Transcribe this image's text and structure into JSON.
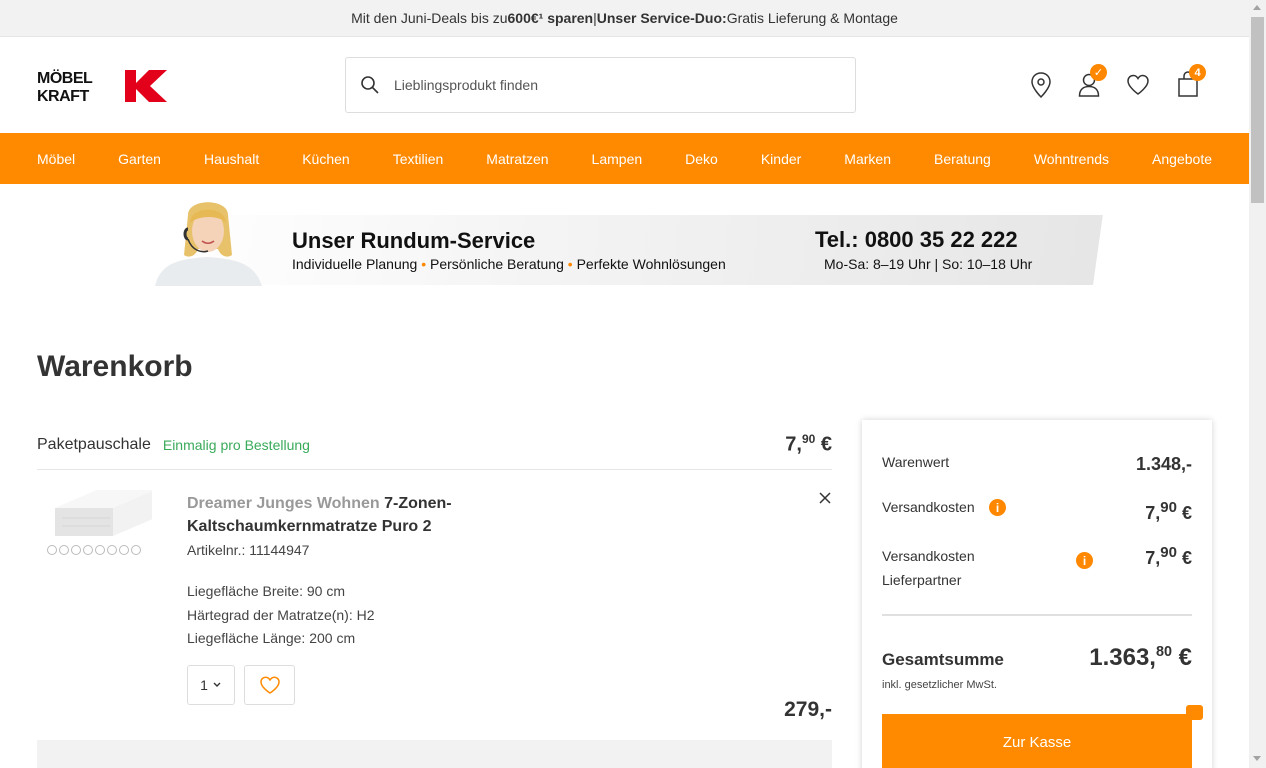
{
  "promo": {
    "text_1": "Mit den Juni-Deals bis zu ",
    "amount": "600€¹ sparen",
    "sep": " | ",
    "service_duo": "Unser Service-Duo:",
    "text_2": " Gratis Lieferung & Montage"
  },
  "logo": {
    "line1": "MÖBEL",
    "line2": "KRAFT",
    "mark": "K"
  },
  "search": {
    "placeholder": "Lieblingsprodukt finden"
  },
  "header": {
    "cart_count": "4",
    "account_badge": "✓"
  },
  "nav": [
    "Möbel",
    "Garten",
    "Haushalt",
    "Küchen",
    "Textilien",
    "Matratzen",
    "Lampen",
    "Deko",
    "Kinder",
    "Marken",
    "Beratung",
    "Wohntrends",
    "Angebote"
  ],
  "service": {
    "title": "Unser Rundum-Service",
    "features": [
      "Individuelle Planung",
      "Persönliche Beratung",
      "Perfekte Wohnlösungen"
    ],
    "tel": "Tel.: 0800 35 22 222",
    "hours": "Mo-Sa: 8–19 Uhr | So: 10–18 Uhr"
  },
  "page_title": "Warenkorb",
  "pakete": {
    "label": "Paketpauschale",
    "note": "Einmalig pro Bestellung",
    "price_main": "7,",
    "price_sup": "90",
    "price_cur": " €"
  },
  "item": {
    "brand": "Dreamer Junges Wohnen",
    "name": " 7-Zonen-Kaltschaumkernmatratze Puro 2",
    "article": "Artikelnr.: 11144947",
    "attrs": [
      "Liegefläche Breite: 90 cm",
      "Härtegrad der Matratze(n): H2",
      "Liegefläche Länge: 200 cm"
    ],
    "qty": "1",
    "price": "279,-"
  },
  "summary": {
    "warenwert_label": "Warenwert",
    "warenwert_value": "1.348,-",
    "versand_label": "Versandkosten",
    "versand_main": "7,",
    "versand_sup": "90",
    "versand_cur": " €",
    "partner_label_1": "Versandkosten",
    "partner_label_2": "Lieferpartner",
    "partner_main": "7,",
    "partner_sup": "90",
    "partner_cur": " €",
    "total_label": "Gesamtsumme",
    "total_main": "1.363,",
    "total_sup": "80",
    "total_cur": " €",
    "vat": "inkl. gesetzlicher MwSt.",
    "checkout": "Zur Kasse",
    "info_glyph": "i"
  },
  "colors": {
    "brand_orange": "#ff8a00",
    "brand_red": "#e2001a",
    "green_note": "#3aaa5a"
  }
}
